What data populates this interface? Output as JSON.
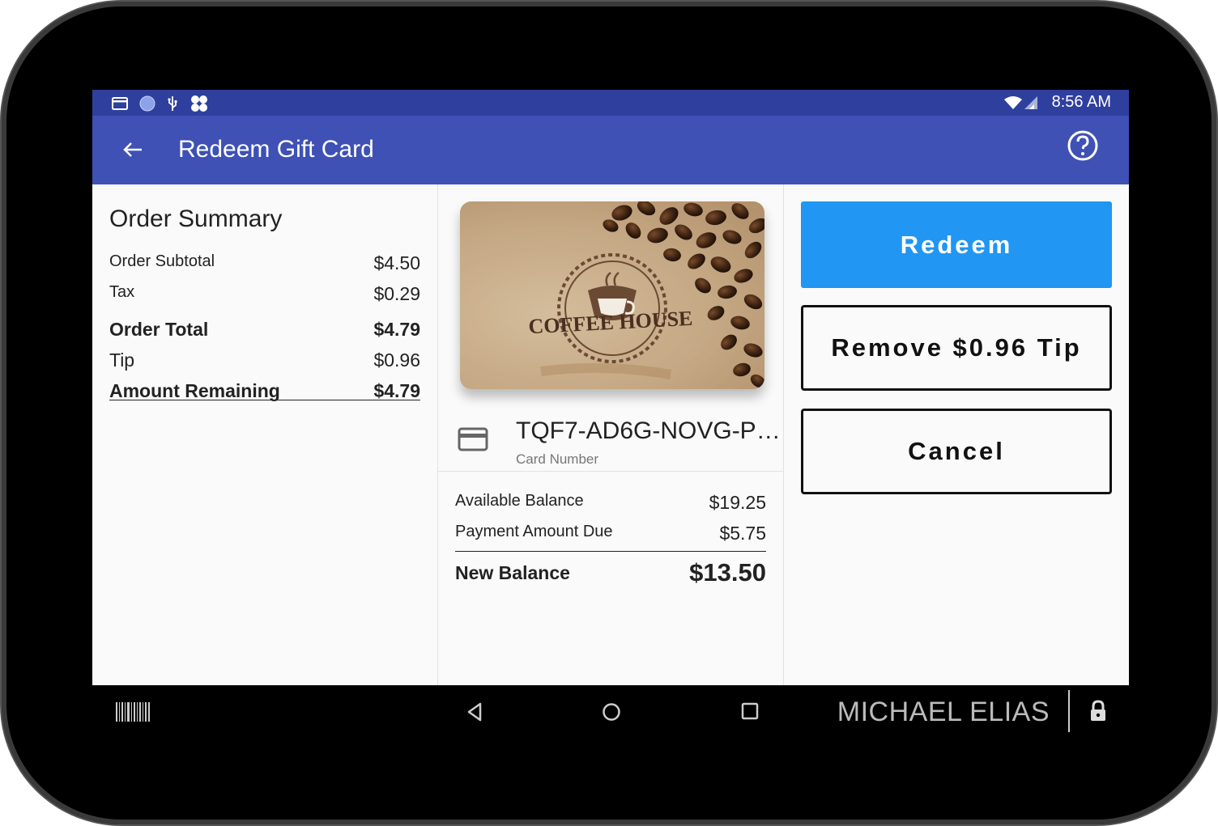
{
  "status_bar": {
    "time": "8:56 AM",
    "left_icons": [
      "card-icon",
      "circle-icon",
      "usb-icon",
      "clover-icon"
    ],
    "right_icons": [
      "wifi-icon",
      "signal-icon"
    ]
  },
  "app_bar": {
    "title": "Redeem Gift Card",
    "back_icon": "arrow-left-icon",
    "help_icon": "help-circle-icon",
    "background": "#3f51b5",
    "status_background": "#2f3f9e"
  },
  "order_summary": {
    "title": "Order Summary",
    "subtotal_label": "Order Subtotal",
    "subtotal_value": "$4.50",
    "tax_label": "Tax",
    "tax_value": "$0.29",
    "total_label": "Order Total",
    "total_value": "$4.79",
    "tip_label": "Tip",
    "tip_value": "$0.96",
    "remaining_label": "Amount Remaining",
    "remaining_value": "$4.79"
  },
  "gift_card": {
    "brand_text": "COFFEE HOUSE",
    "card_number": "TQF7-AD6G-NOVG-P…",
    "card_number_caption": "Card Number",
    "available_balance_label": "Available Balance",
    "available_balance_value": "$19.25",
    "payment_due_label": "Payment Amount Due",
    "payment_due_value": "$5.75",
    "new_balance_label": "New Balance",
    "new_balance_value": "$13.50"
  },
  "actions": {
    "redeem_label": "Redeem",
    "remove_tip_label": "Remove $0.96 Tip",
    "cancel_label": "Cancel",
    "primary_color": "#2196f3"
  },
  "nav_bar": {
    "user_name": "MICHAEL ELIAS",
    "icons": [
      "barcode-icon",
      "nav-back-icon",
      "nav-home-icon",
      "nav-recent-icon",
      "lock-icon"
    ]
  }
}
